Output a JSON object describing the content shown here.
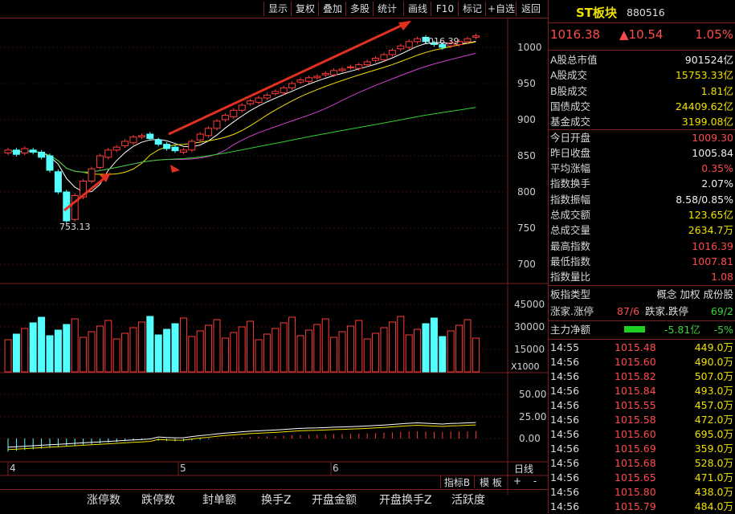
{
  "toolbar": {
    "buttons": [
      "显示",
      "复权",
      "叠加",
      "多股",
      "统计",
      "画线",
      "F10",
      "标记",
      "+自选",
      "返回"
    ]
  },
  "header": {
    "name": "ST板块",
    "code": "880516",
    "price": "1016.38",
    "change": "▲10.54",
    "pct": "1.05%"
  },
  "stats": [
    {
      "label": "A股总市值",
      "value": "901524亿",
      "color": "white"
    },
    {
      "label": "A股成交",
      "value": "15753.33亿",
      "color": "yellow"
    },
    {
      "label": "B股成交",
      "value": "1.81亿",
      "color": "yellow"
    },
    {
      "label": "国债成交",
      "value": "24409.62亿",
      "color": "yellow"
    },
    {
      "label": "基金成交",
      "value": "3199.08亿",
      "color": "yellow"
    },
    {
      "label": "今日开盘",
      "value": "1009.30",
      "color": "red"
    },
    {
      "label": "昨日收盘",
      "value": "1005.84",
      "color": "white"
    },
    {
      "label": "平均涨幅",
      "value": "0.35%",
      "color": "red"
    },
    {
      "label": "指数换手",
      "value": "2.07%",
      "color": "white"
    },
    {
      "label": "指数振幅",
      "value": "8.58/0.85%",
      "color": "white"
    },
    {
      "label": "总成交额",
      "value": "123.65亿",
      "color": "yellow"
    },
    {
      "label": "总成交量",
      "value": "2634.7万",
      "color": "yellow"
    },
    {
      "label": "最高指数",
      "value": "1016.39",
      "color": "red"
    },
    {
      "label": "最低指数",
      "value": "1007.81",
      "color": "red"
    },
    {
      "label": "指数量比",
      "value": "1.08",
      "color": "red"
    }
  ],
  "board": {
    "type_label": "板指类型",
    "type_value": "概念 加权 成份股",
    "up_label": "涨家.涨停",
    "up_value": "87/6",
    "down_label": "跌家.跌停",
    "down_value": "69/2",
    "main_label": "主力净额",
    "main_value": "-5.81亿",
    "main_pct": "-5%"
  },
  "ticks": [
    {
      "time": "14:55",
      "price": "1015.48",
      "vol": "449.0万"
    },
    {
      "time": "14:56",
      "price": "1015.60",
      "vol": "490.0万"
    },
    {
      "time": "14:56",
      "price": "1015.82",
      "vol": "507.0万"
    },
    {
      "time": "14:56",
      "price": "1015.84",
      "vol": "493.0万"
    },
    {
      "time": "14:56",
      "price": "1015.55",
      "vol": "457.0万"
    },
    {
      "time": "14:56",
      "price": "1015.58",
      "vol": "472.0万"
    },
    {
      "time": "14:56",
      "price": "1015.60",
      "vol": "695.0万"
    },
    {
      "time": "14:56",
      "price": "1015.69",
      "vol": "359.0万"
    },
    {
      "time": "14:56",
      "price": "1015.68",
      "vol": "528.0万"
    },
    {
      "time": "14:56",
      "price": "1015.65",
      "vol": "471.0万"
    },
    {
      "time": "14:56",
      "price": "1015.80",
      "vol": "438.0万"
    },
    {
      "time": "14:56",
      "price": "1015.79",
      "vol": "484.0万"
    }
  ],
  "chart_data": {
    "type": "candlestick",
    "price_axis": [
      "1000",
      "950",
      "900",
      "850",
      "800",
      "750",
      "700"
    ],
    "volume_axis": [
      "45000",
      "30000",
      "15000"
    ],
    "volume_unit": "X1000",
    "macd_axis": [
      "50.00",
      "25.00",
      "0.00"
    ],
    "month_labels": [
      "4",
      "5",
      "6"
    ],
    "high_label": "1016.39",
    "low_label": "753.13",
    "closes": [
      858,
      852,
      860,
      855,
      848,
      830,
      800,
      760,
      795,
      815,
      832,
      850,
      858,
      862,
      870,
      876,
      878,
      874,
      866,
      860,
      857,
      858,
      870,
      880,
      888,
      898,
      906,
      913,
      920,
      926,
      930,
      934,
      939,
      944,
      950,
      955,
      958,
      960,
      964,
      968,
      970,
      973,
      976,
      980,
      985,
      990,
      996,
      1002,
      1008,
      1012,
      1008,
      1004,
      1000,
      1006,
      1008,
      1012,
      1016
    ]
  },
  "bottom": {
    "tabs_right": [
      "指标B",
      "模 板",
      "+",
      "-"
    ],
    "dayline": "日线",
    "headers": [
      "涨停数",
      "跌停数",
      "封单额",
      "换手Z",
      "开盘金额",
      "开盘换手Z",
      "活跃度"
    ]
  }
}
